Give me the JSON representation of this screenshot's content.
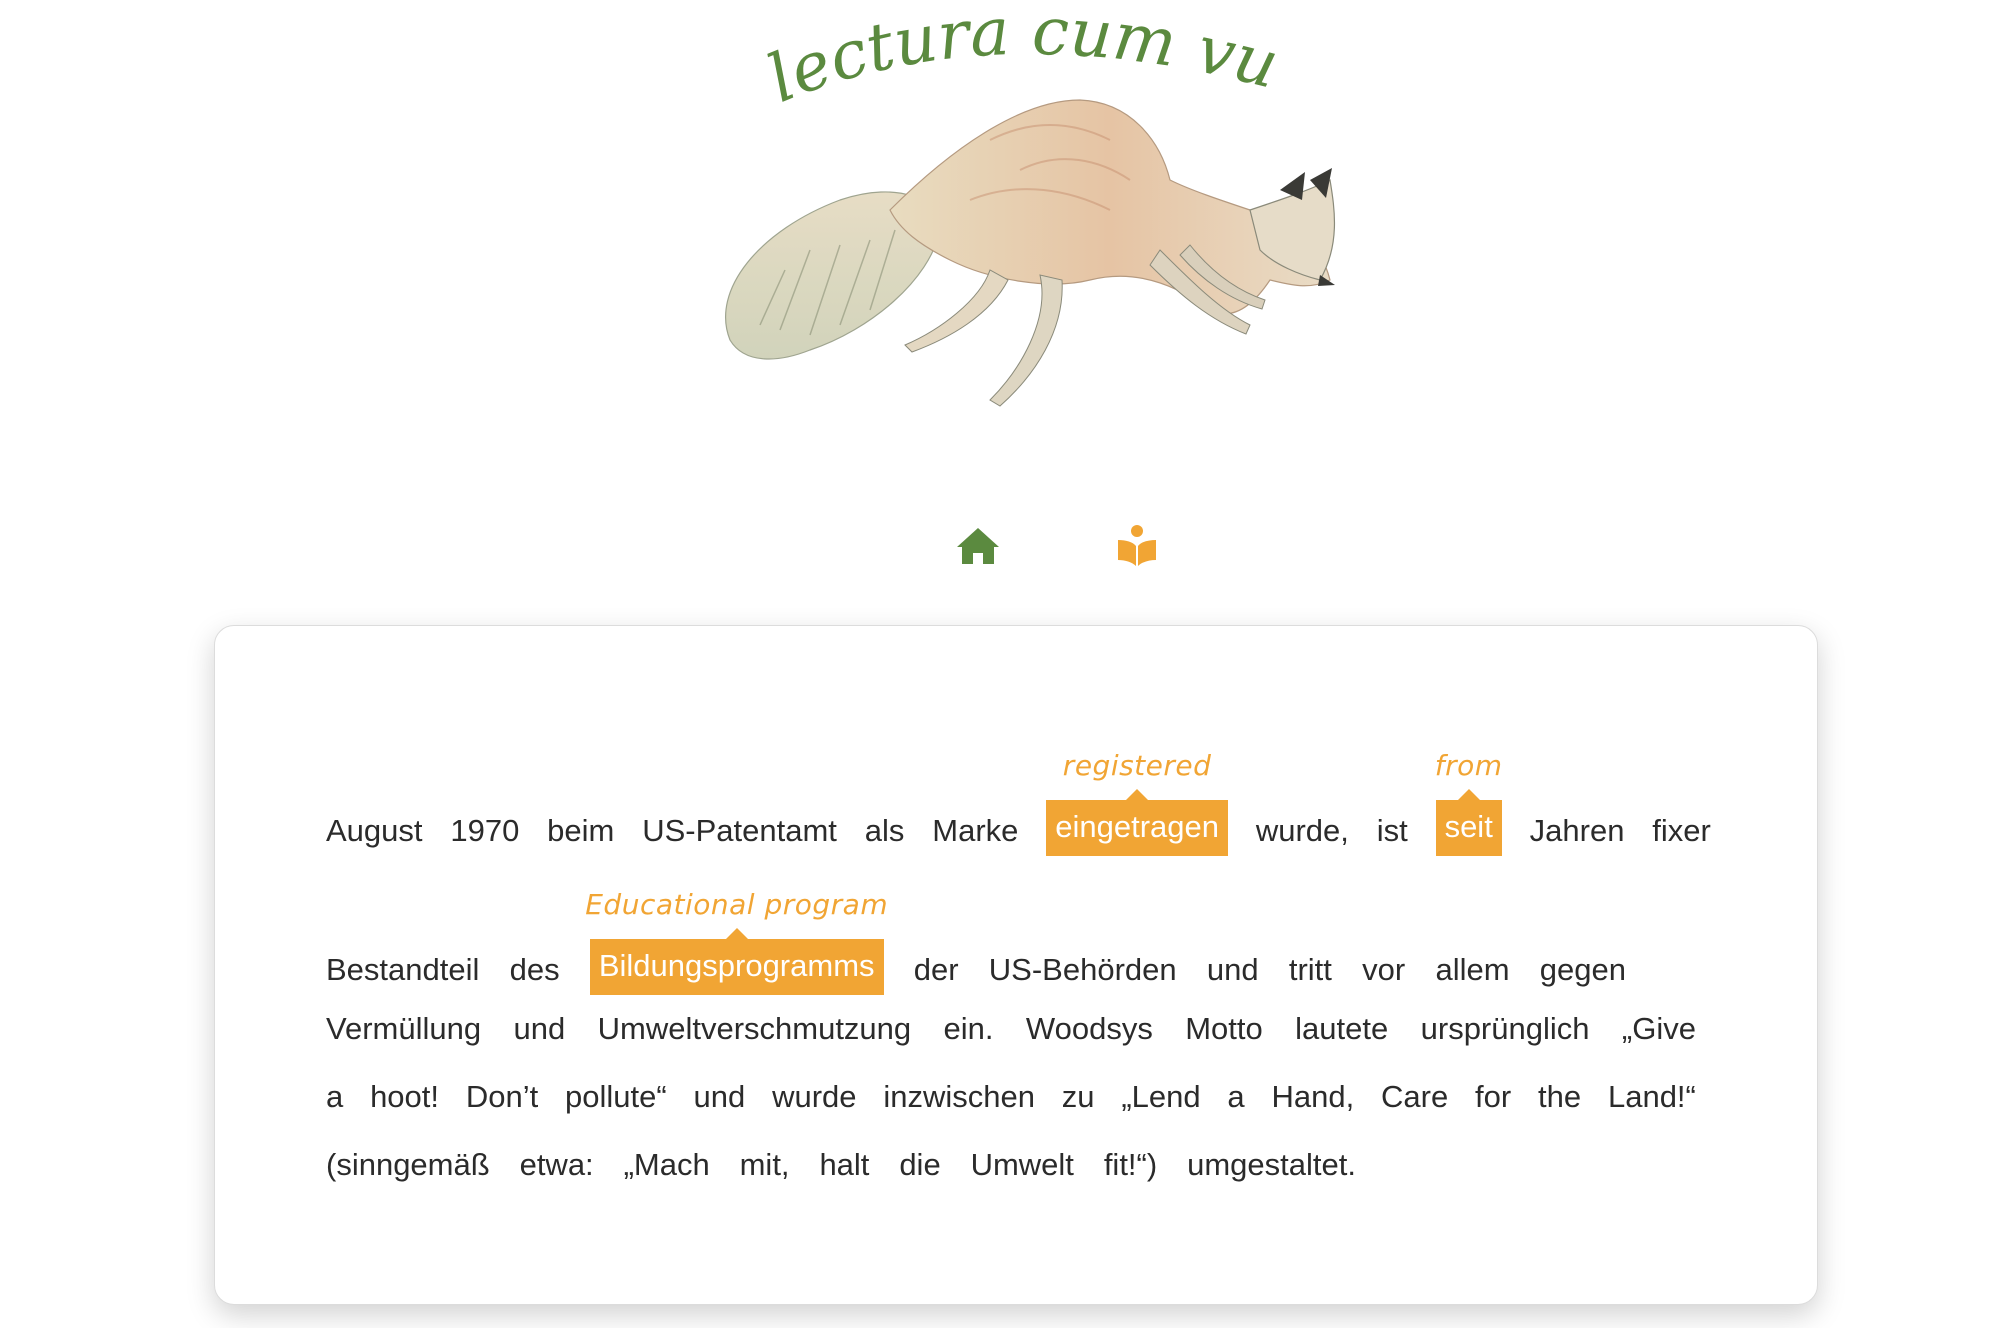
{
  "logo": {
    "title": "lectura cum vulpe",
    "fox_image": "fox-illustration"
  },
  "nav": {
    "items": [
      {
        "icon": "home-icon",
        "color": "#5b8a3f"
      },
      {
        "icon": "reader-icon",
        "color": "#f1a534"
      }
    ]
  },
  "colors": {
    "brand_green": "#5b8a3f",
    "accent_orange": "#f1a534",
    "text": "#2b2b2b"
  },
  "reading": {
    "lines": [
      {
        "w1": "August",
        "w2": "1970",
        "w3": "beim",
        "w4": "US-Patentamt",
        "w5": "als",
        "w6": "Marke",
        "hl1": "eingetragen",
        "gloss1": "registered",
        "w7": "wurde,",
        "w8": "ist",
        "hl2": "seit",
        "gloss2": "from",
        "w9": "Jahren",
        "w10": "fixer"
      },
      {
        "w1": "Bestandteil",
        "w2": "des",
        "hl1": "Bildungsprogramms",
        "gloss1": "Educational program",
        "w3": "der",
        "w4": "US-Behörden",
        "w5": "und",
        "w6": "tritt",
        "w7": "vor",
        "w8": "allem",
        "w9": "gegen"
      },
      {
        "text": [
          "Vermüllung",
          "und",
          "Umweltverschmutzung",
          "ein.",
          "Woodsys",
          "Motto",
          "lautete",
          "ursprünglich",
          "„Give"
        ]
      },
      {
        "text": [
          "a",
          "hoot!",
          "Don’t",
          "pollute“",
          "und",
          "wurde",
          "inzwischen",
          "zu",
          "„Lend",
          "a",
          "Hand,",
          "Care",
          "for",
          "the",
          "Land!“"
        ]
      },
      {
        "text": [
          "(sinngemäß",
          "etwa:",
          "„Mach",
          "mit,",
          "halt",
          "die",
          "Umwelt",
          "fit!“)",
          "umgestaltet."
        ]
      }
    ]
  }
}
